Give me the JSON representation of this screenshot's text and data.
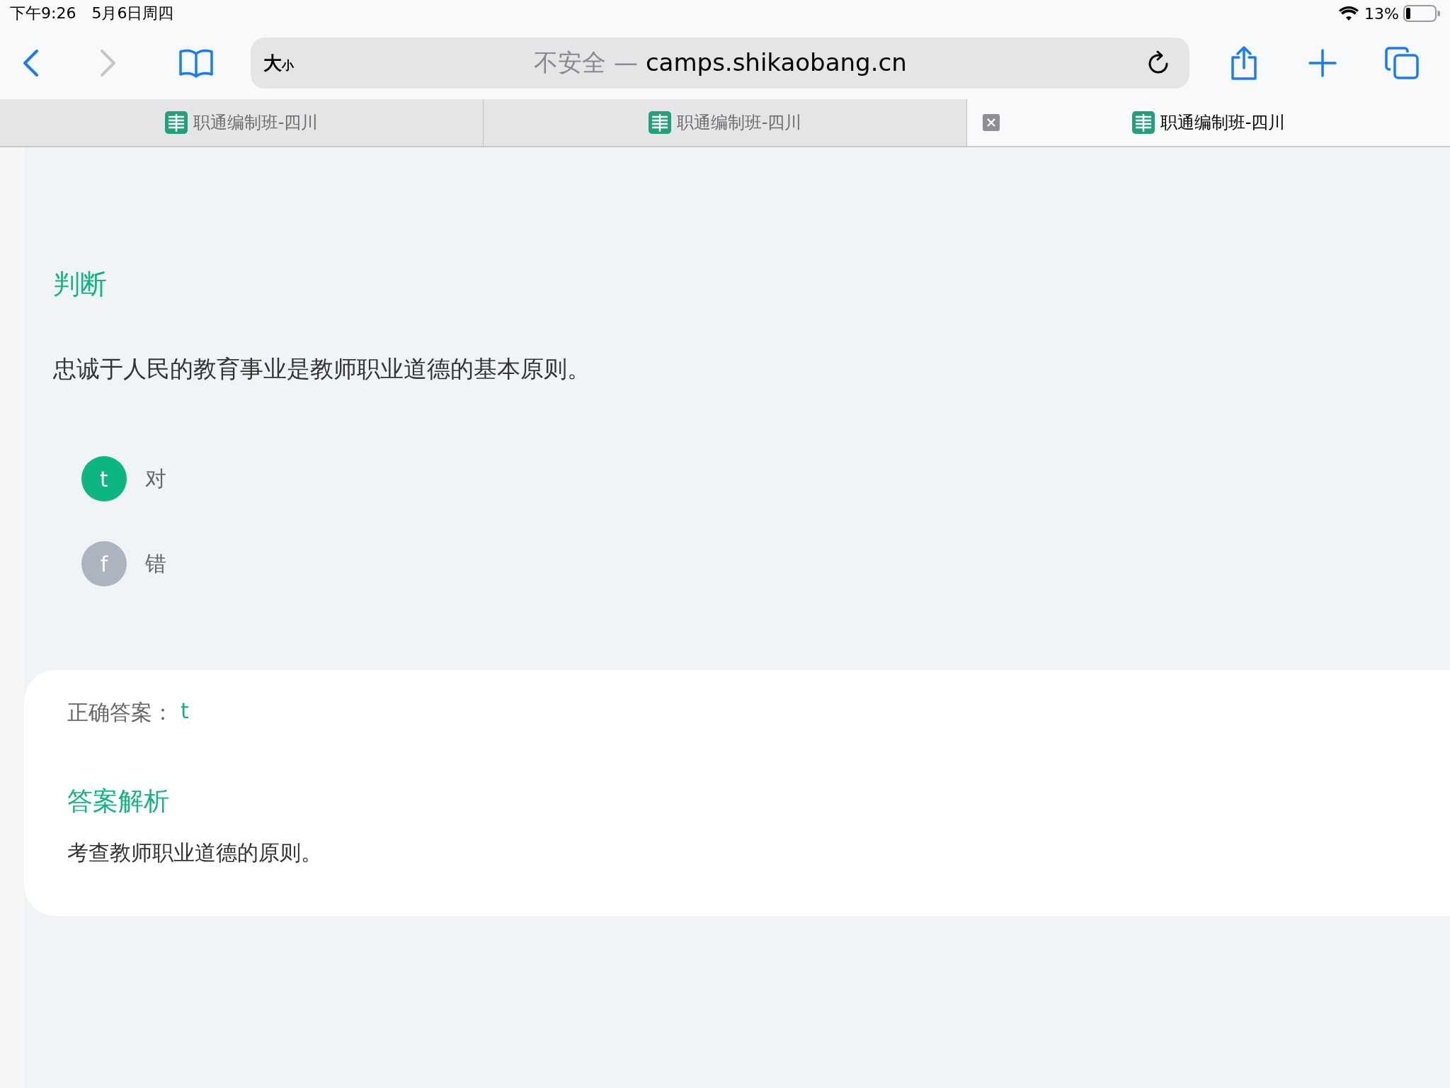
{
  "status_bar": {
    "time": "下午9:26",
    "date": "5月6日周四",
    "battery": "13%"
  },
  "toolbar": {
    "text_size": {
      "large": "大",
      "small": "小"
    },
    "security_label": "不安全 —",
    "url": "camps.shikaobang.cn"
  },
  "tabs": [
    {
      "title": "职通编制班-四川",
      "selected": false
    },
    {
      "title": "职通编制班-四川",
      "selected": false
    },
    {
      "title": "职通编制班-四川",
      "selected": true
    }
  ],
  "question": {
    "type_label": "判断",
    "text": "忠诚于人民的教育事业是教师职业道德的基本原则。",
    "options": [
      {
        "key": "t",
        "label": "对",
        "selected": true
      },
      {
        "key": "f",
        "label": "错",
        "selected": false
      }
    ]
  },
  "answer_card": {
    "correct_label": "正确答案：",
    "correct_value": "t",
    "analysis_title": "答案解析",
    "analysis_text": "考查教师职业道德的原则。"
  }
}
